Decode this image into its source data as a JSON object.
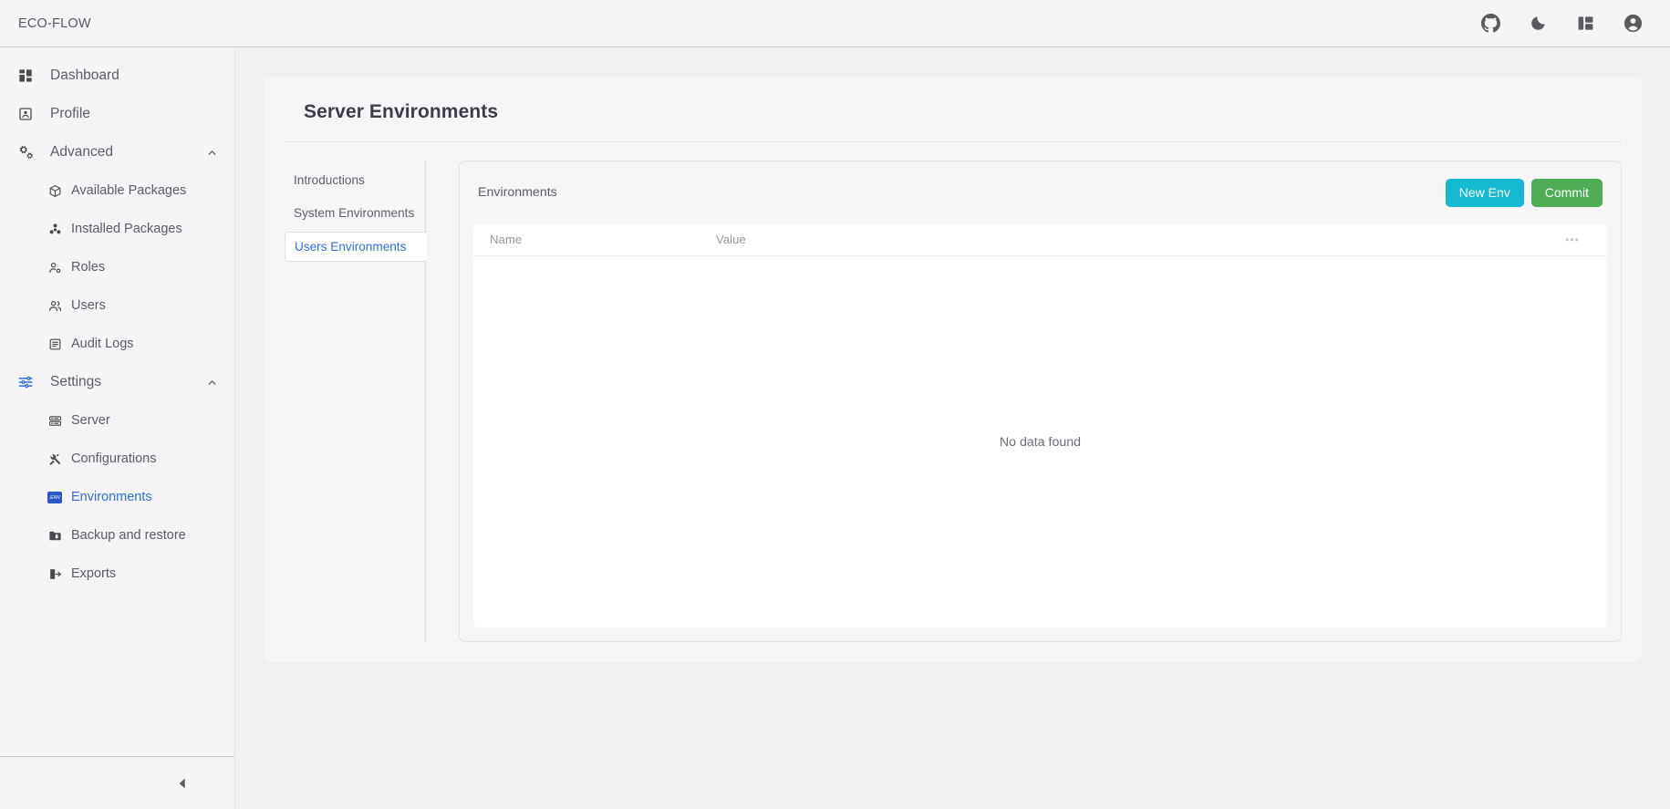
{
  "topbar": {
    "brand": "ECO-FLOW",
    "icons": [
      {
        "name": "github-icon",
        "label": "GitHub"
      },
      {
        "name": "dark-mode-icon",
        "label": "Dark mode"
      },
      {
        "name": "layout-icon",
        "label": "Layout"
      },
      {
        "name": "account-icon",
        "label": "Account"
      }
    ]
  },
  "sidebar": {
    "items": [
      {
        "label": "Dashboard",
        "icon": "dashboard-icon",
        "type": "item"
      },
      {
        "label": "Profile",
        "icon": "profile-icon",
        "type": "item"
      },
      {
        "label": "Advanced",
        "icon": "advanced-icon",
        "type": "group",
        "expanded": true
      },
      {
        "label": "Available Packages",
        "icon": "package-icon",
        "type": "sub"
      },
      {
        "label": "Installed Packages",
        "icon": "installed-packages-icon",
        "type": "sub"
      },
      {
        "label": "Roles",
        "icon": "roles-icon",
        "type": "sub"
      },
      {
        "label": "Users",
        "icon": "users-icon",
        "type": "sub"
      },
      {
        "label": "Audit Logs",
        "icon": "audit-logs-icon",
        "type": "sub"
      },
      {
        "label": "Settings",
        "icon": "settings-icon",
        "type": "group",
        "expanded": true
      },
      {
        "label": "Server",
        "icon": "server-icon",
        "type": "sub"
      },
      {
        "label": "Configurations",
        "icon": "configurations-icon",
        "type": "sub"
      },
      {
        "label": "Environments",
        "icon": "env-icon",
        "type": "sub",
        "active": true
      },
      {
        "label": "Backup and restore",
        "icon": "backup-icon",
        "type": "sub"
      },
      {
        "label": "Exports",
        "icon": "exports-icon",
        "type": "sub"
      }
    ],
    "env_badge_text": ".ENV",
    "collapse_icon": "collapse-sidebar-icon"
  },
  "page": {
    "title": "Server Environments",
    "tabs": [
      {
        "label": "Introductions",
        "active": false
      },
      {
        "label": "System Environments",
        "active": false
      },
      {
        "label": "Users Environments",
        "active": true
      }
    ]
  },
  "panel": {
    "title": "Environments",
    "new_env_label": "New Env",
    "commit_label": "Commit",
    "new_env_color": "#17b8d4",
    "commit_color": "#4cad55",
    "table": {
      "columns": [
        "Name",
        "Value"
      ],
      "more_label": "•••",
      "rows": [],
      "empty_message": "No data found"
    }
  },
  "colors": {
    "accent": "#2f6fe0",
    "page_bg": "#f1f1f1",
    "chrome_bg": "#f5f5f7"
  }
}
